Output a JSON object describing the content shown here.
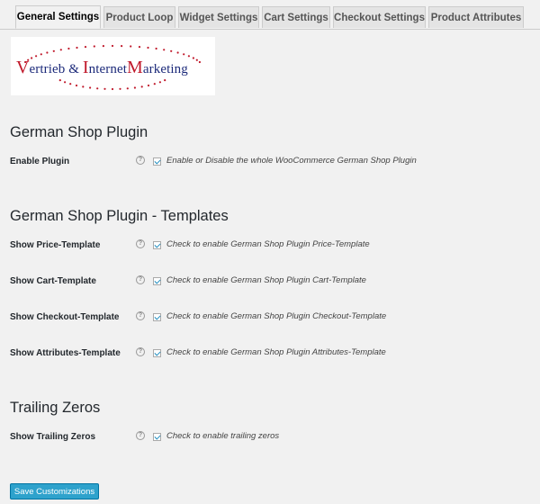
{
  "tabs": [
    {
      "label": "General Settings",
      "active": true
    },
    {
      "label": "Product Loop"
    },
    {
      "label": "Widget Settings"
    },
    {
      "label": "Cart Settings"
    },
    {
      "label": "Checkout Settings"
    },
    {
      "label": "Product Attributes"
    }
  ],
  "logo": {
    "v_cap": "V",
    "v_rest": "ertrieb & ",
    "i_cap": "I",
    "i_rest": "nternet",
    "m_cap": "M",
    "m_rest": "arketing"
  },
  "sections": [
    {
      "title": "German Shop Plugin",
      "rows": [
        {
          "label": "Enable Plugin",
          "description": "Enable or Disable the whole WooCommerce German Shop Plugin",
          "checked": true
        }
      ]
    },
    {
      "title": "German Shop Plugin - Templates",
      "rows": [
        {
          "label": "Show Price-Template",
          "description": "Check to enable German Shop Plugin Price-Template",
          "checked": true
        },
        {
          "label": "Show Cart-Template",
          "description": "Check to enable German Shop Plugin Cart-Template",
          "checked": true
        },
        {
          "label": "Show Checkout-Template",
          "description": "Check to enable German Shop Plugin Checkout-Template",
          "checked": true
        },
        {
          "label": "Show Attributes-Template",
          "description": "Check to enable German Shop Plugin Attributes-Template",
          "checked": true
        }
      ]
    },
    {
      "title": "Trailing Zeros",
      "rows": [
        {
          "label": "Show Trailing Zeros",
          "description": "Check to enable trailing zeros",
          "checked": true
        }
      ]
    }
  ],
  "help_glyph": "?",
  "save_button": {
    "label": "Save Customizations"
  },
  "colors": {
    "accent": "#2ea2cc",
    "logo_blue": "#1c2a7a",
    "logo_red": "#c0182a",
    "checkmark": "#1e8cbe"
  }
}
